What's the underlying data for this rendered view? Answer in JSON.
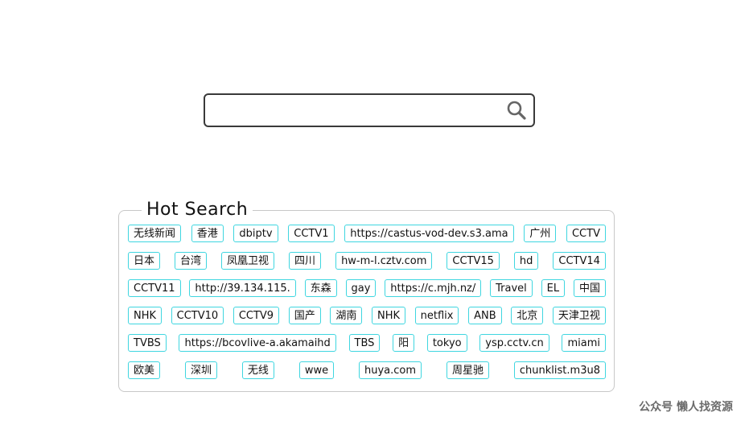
{
  "search": {
    "value": "",
    "placeholder": ""
  },
  "hot_search": {
    "title": "Hot  Search",
    "rows": [
      [
        "无线新闻",
        "香港",
        "dbiptv",
        "CCTV1",
        "https://castus-vod-dev.s3.ama",
        "广州",
        "CCTV"
      ],
      [
        "日本",
        "台湾",
        "凤凰卫视",
        "四川",
        "hw-m-l.cztv.com",
        "CCTV15",
        "hd",
        "CCTV14"
      ],
      [
        "CCTV11",
        "http://39.134.115.",
        "东森",
        "gay",
        "https://c.mjh.nz/",
        "Travel",
        "EL",
        "中国"
      ],
      [
        "NHK",
        "CCTV10",
        "CCTV9",
        "国产",
        "湖南",
        "NHK",
        "netflix",
        "ANB",
        "北京",
        "天津卫视"
      ],
      [
        "TVBS",
        "https://bcovlive-a.akamaihd",
        "TBS",
        "阳",
        "tokyo",
        "ysp.cctv.cn",
        "miami"
      ],
      [
        "欧美",
        "深圳",
        "无线",
        "wwe",
        "huya.com",
        "周星驰",
        "chunklist.m3u8"
      ]
    ]
  },
  "watermark": "公众号 懒人找资源",
  "colors": {
    "tag_border": "#3fd6e0",
    "search_border": "#3a3a3a",
    "panel_border": "#c8c8c8"
  }
}
